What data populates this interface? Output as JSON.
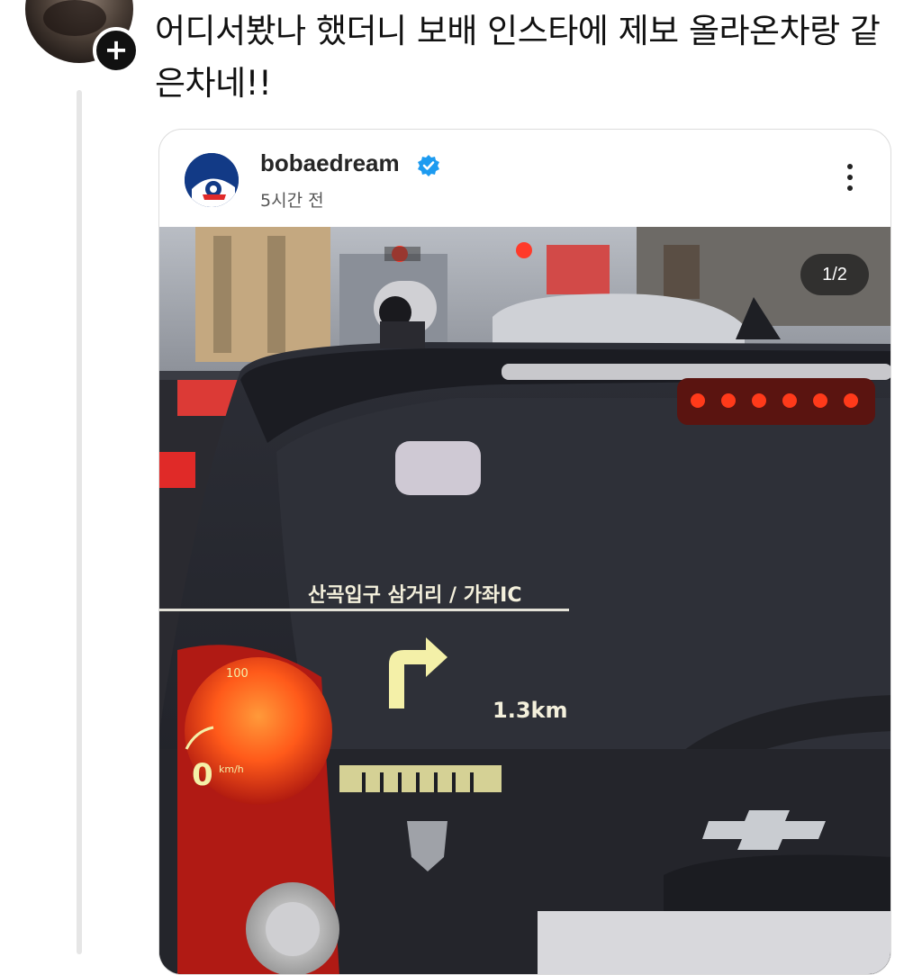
{
  "post": {
    "text": "어디서봤나 했더니 보배 인스타에 제보 올라온차랑 같은차네!!",
    "follow_symbol": "+"
  },
  "embed": {
    "username": "bobaedream",
    "time": "5시간 전",
    "carousel_counter": "1/2",
    "verified": true
  },
  "photo": {
    "hud_destination": "산곡입구 삼거리 / 가좌IC",
    "hud_distance": "1.3km",
    "hud_speed": "0",
    "hud_speed_unit": "km/h",
    "hud_gauge_mark": "100",
    "brake_light_color": "#ff2a1a"
  },
  "colors": {
    "accent": "#1d9bf0",
    "logo_bg": "#123a86",
    "hud_yellow": "#f4f0a8"
  }
}
